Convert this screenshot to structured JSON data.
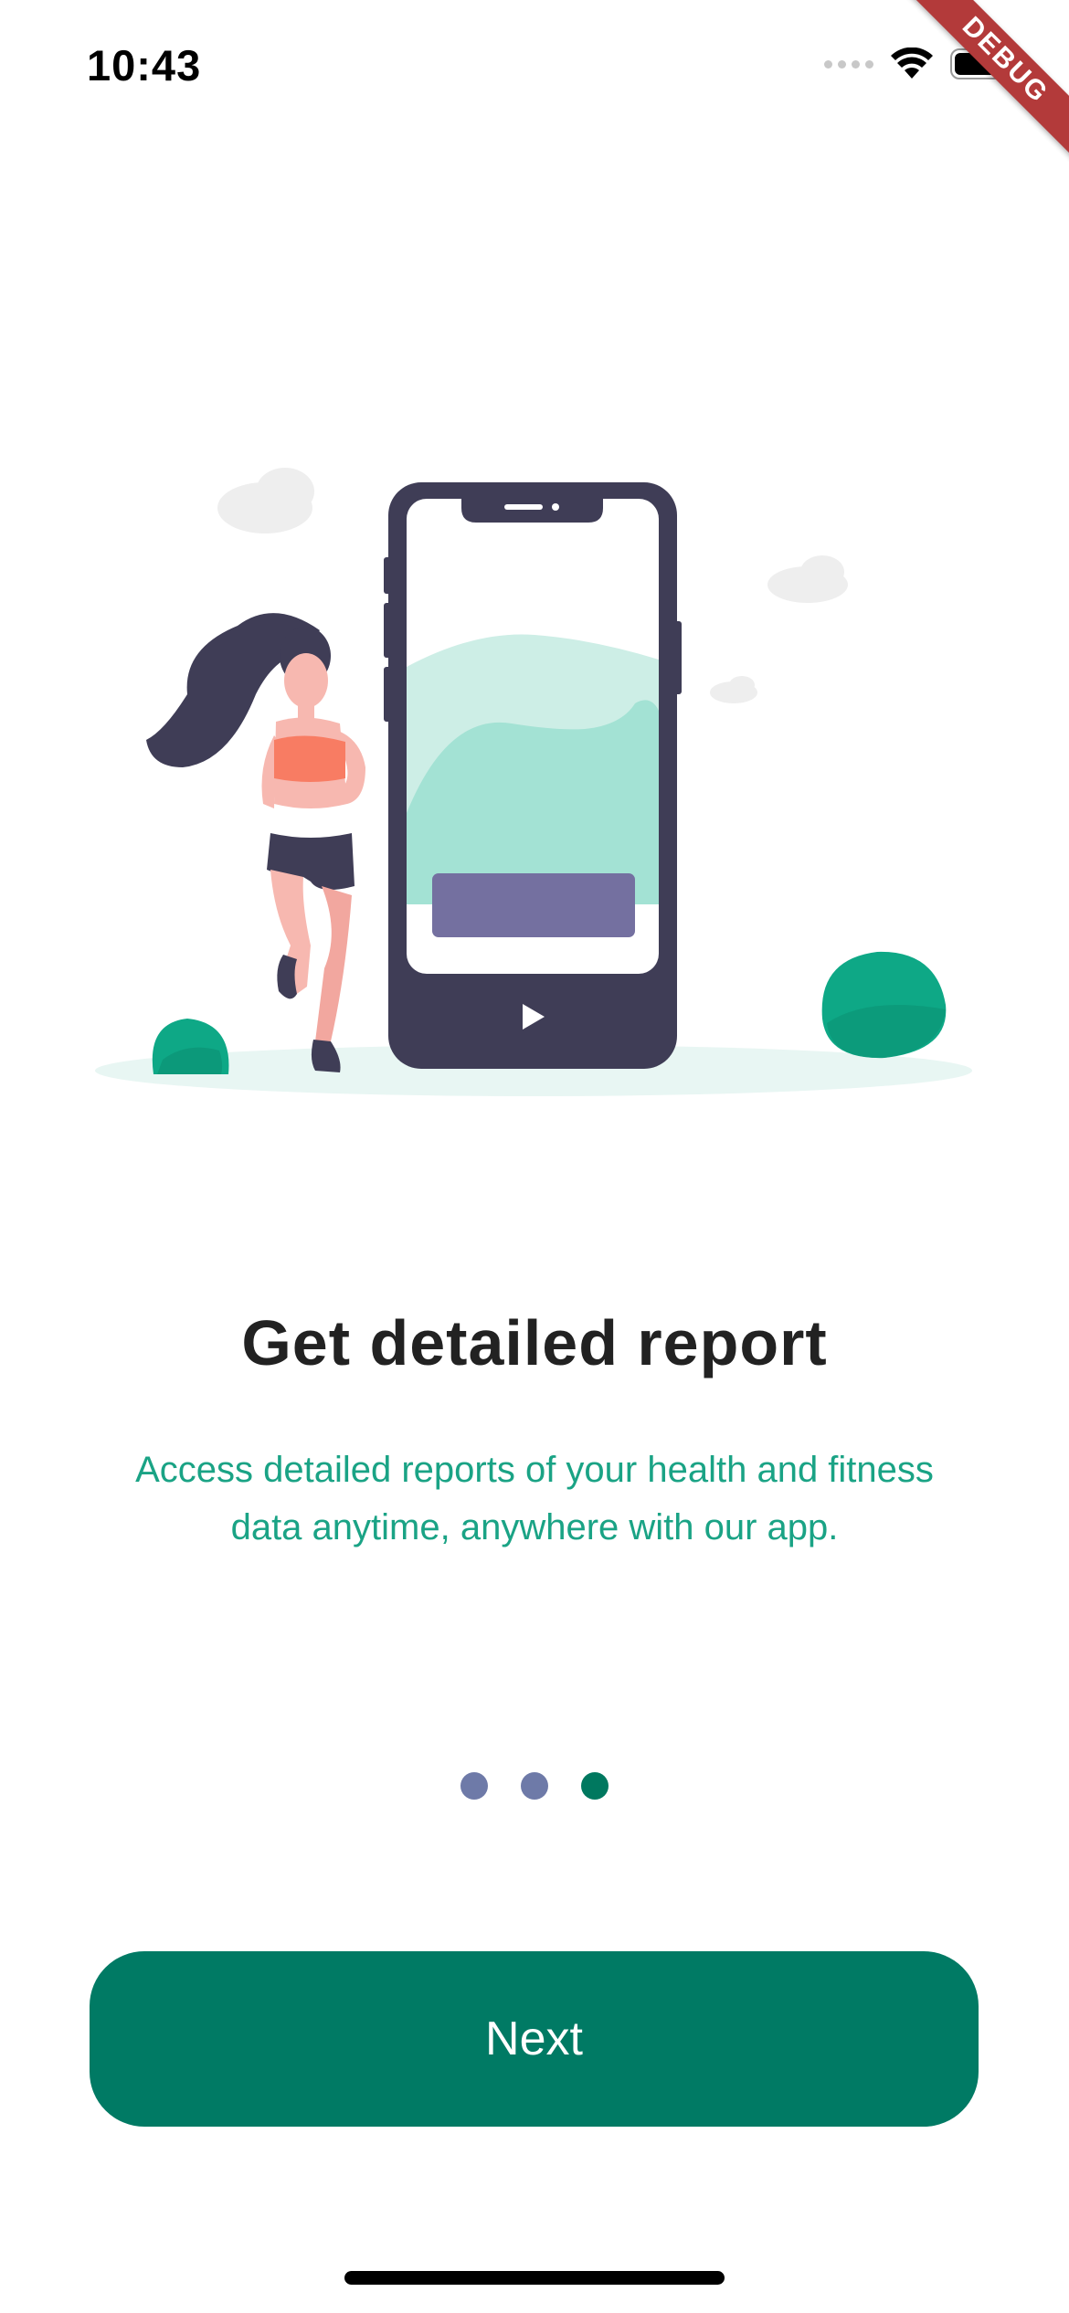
{
  "status_bar": {
    "time": "10:43",
    "signal_icon": "signal-dots-icon",
    "wifi_icon": "wifi-icon",
    "battery_icon": "battery-icon"
  },
  "debug_banner": {
    "label": "DEBUG",
    "color": "#b33a3a"
  },
  "illustration": {
    "name": "runner-with-phone-illustration",
    "colors": {
      "phone": "#3f3d56",
      "hills_light": "#cdeee6",
      "hills_dark": "#a3e2d4",
      "bar": "#7470a0",
      "bush": "#0ea886",
      "ground": "#e8f6f3",
      "top": "#f87c63",
      "skin": "#f7b8b0"
    }
  },
  "onboarding": {
    "title": "Get detailed report",
    "description": "Access detailed reports of your health and fitness data anytime, anywhere with our app.",
    "page_count": 3,
    "active_page": 3
  },
  "actions": {
    "next_label": "Next"
  },
  "colors": {
    "primary": "#007a64",
    "accent_text": "#1aa385",
    "indicator_inactive": "#6e7aa8",
    "indicator_active": "#00785f"
  }
}
